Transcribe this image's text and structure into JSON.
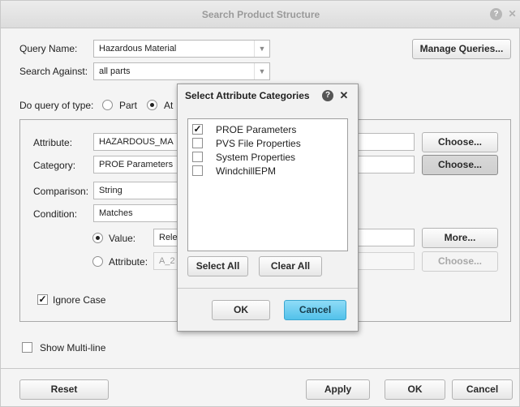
{
  "window": {
    "title": "Search Product Structure"
  },
  "query": {
    "name_label": "Query Name:",
    "name_value": "Hazardous Material",
    "search_against_label": "Search Against:",
    "search_against_value": "all parts",
    "manage_queries": "Manage Queries...",
    "do_query_label": "Do query of type:",
    "type_part": "Part",
    "type_attr": "At"
  },
  "criteria": {
    "attribute_label": "Attribute:",
    "attribute_value": "HAZARDOUS_MA",
    "category_label": "Category:",
    "category_value": "PROE Parameters",
    "comparison_label": "Comparison:",
    "comparison_value": "String",
    "condition_label": "Condition:",
    "condition_value": "Matches",
    "value_label": "Value:",
    "value_value": "Rele",
    "attr2_label": "Attribute:",
    "attr2_value": "A_2",
    "choose": "Choose...",
    "more": "More...",
    "ignore_case": "Ignore Case"
  },
  "show_multiline": "Show Multi-line",
  "footer": {
    "reset": "Reset",
    "apply": "Apply",
    "ok": "OK",
    "cancel": "Cancel"
  },
  "dialog": {
    "title": "Select Attribute Categories",
    "items": [
      {
        "label": "PROE Parameters",
        "checked": true
      },
      {
        "label": "PVS File Properties",
        "checked": false
      },
      {
        "label": "System Properties",
        "checked": false
      },
      {
        "label": "WindchillEPM",
        "checked": false
      }
    ],
    "select_all": "Select All",
    "clear_all": "Clear All",
    "ok": "OK",
    "cancel": "Cancel"
  },
  "colors": {
    "primary_button": "#52c1ea",
    "title_text": "#9a9a9a"
  },
  "icons": {
    "help": "help-icon",
    "close": "close-icon",
    "dropdown": "chevron-down-icon",
    "check": "checkmark-icon"
  }
}
